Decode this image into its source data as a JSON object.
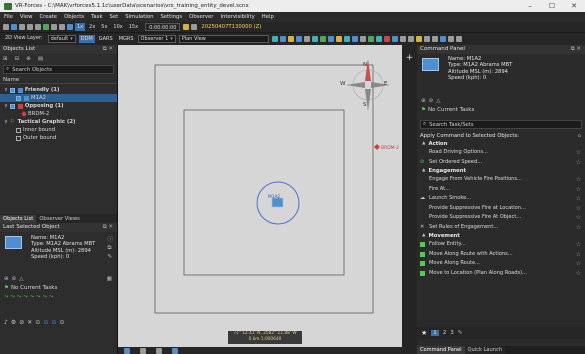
{
  "window": {
    "title": "VR-Forces - C:\\MAK\\vrforces5.1.1c\\userData\\scenarios\\vrx_training_entity_devel.scnx",
    "controls": [
      "–",
      "☐",
      "✕"
    ]
  },
  "menu": [
    "File",
    "View",
    "Create",
    "Objects",
    "Task",
    "Set",
    "Simulation",
    "Settings",
    "Observer",
    "Intervisibility",
    "Help"
  ],
  "toolbar1": {
    "speed_opts": [
      "1x",
      "2x",
      "5x",
      "10x",
      "15x"
    ],
    "time": "0:00:00:00",
    "date": "20250407T130000 (Z)"
  },
  "toolbar2": {
    "view_label": "2D View Layer:",
    "view_value": "default",
    "coord_buttons": [
      "DDM",
      "GARS",
      "MGRS"
    ],
    "observer": "Observer 1",
    "view_mode": "Plan View"
  },
  "objects_list": {
    "title": "Objects List",
    "search_placeholder": "Search Objects",
    "col_name": "Name",
    "tree": [
      {
        "label": "Friendly (1)",
        "level": 0,
        "bold": true,
        "color": "#4f8fd0"
      },
      {
        "label": "M1A2",
        "level": 1,
        "selected": true,
        "color": "#4f8fd0"
      },
      {
        "label": "Opposing (1)",
        "level": 0,
        "bold": true,
        "color": "#d04040"
      },
      {
        "label": "BRDM-2",
        "level": 1,
        "color": "#d04040"
      },
      {
        "label": "Tactical Graphic (2)",
        "level": 0,
        "bold": true,
        "color": "#d8a030"
      },
      {
        "label": "Inner bound",
        "level": 1,
        "color": "#888888"
      },
      {
        "label": "Outer bound",
        "level": 1,
        "color": "#888888"
      }
    ],
    "tabs": [
      "Objects List",
      "Observer Views"
    ]
  },
  "last_selected": {
    "title": "Last Selected Object",
    "name": "Name: M1A2",
    "type": "Type: M1A2 Abrams MBT",
    "alt": "Altitude MSL (m): 2894",
    "speed": "Speed (kph): 0",
    "tasks": "No Current Tasks"
  },
  "map": {
    "scale_line1": "71° 12.41' N, 2562° 11.88' W",
    "scale_line2": "0 km  1:000640"
  },
  "command_panel": {
    "title": "Command Panel",
    "name": "Name: M1A2",
    "type": "Type: M1A2 Abrams MBT",
    "alt": "Altitude MSL (m): 2894",
    "speed": "Speed (kph): 0",
    "tasks": "No Current Tasks",
    "search_placeholder": "Search Task/Sets",
    "apply_label": "Apply Command to Selected Objects:",
    "sections": [
      {
        "header": "Action",
        "items": [
          "Road Driving Options...",
          "Set Ordered Speed..."
        ]
      },
      {
        "header": "Engagement",
        "items": [
          "Engage From Vehicle Fire Positions...",
          "Fire At...",
          "Launch Smoke...",
          "Provide Suppressive Fire at Location...",
          "Provide Suppressive Fire At Object...",
          "Set Rules of Engagement..."
        ]
      },
      {
        "header": "Movement",
        "items": [
          "Follow Entity...",
          "Move Along Route with Actions...",
          "Move Along Route...",
          "Move to Location (Plan Along Roads)..."
        ]
      }
    ],
    "pager": [
      "1",
      "2",
      "3"
    ],
    "bottom_tabs": [
      "Command Panel",
      "Quick Launch"
    ]
  },
  "compass": {
    "n": "N",
    "s": "S",
    "e": "E",
    "w": "W"
  }
}
